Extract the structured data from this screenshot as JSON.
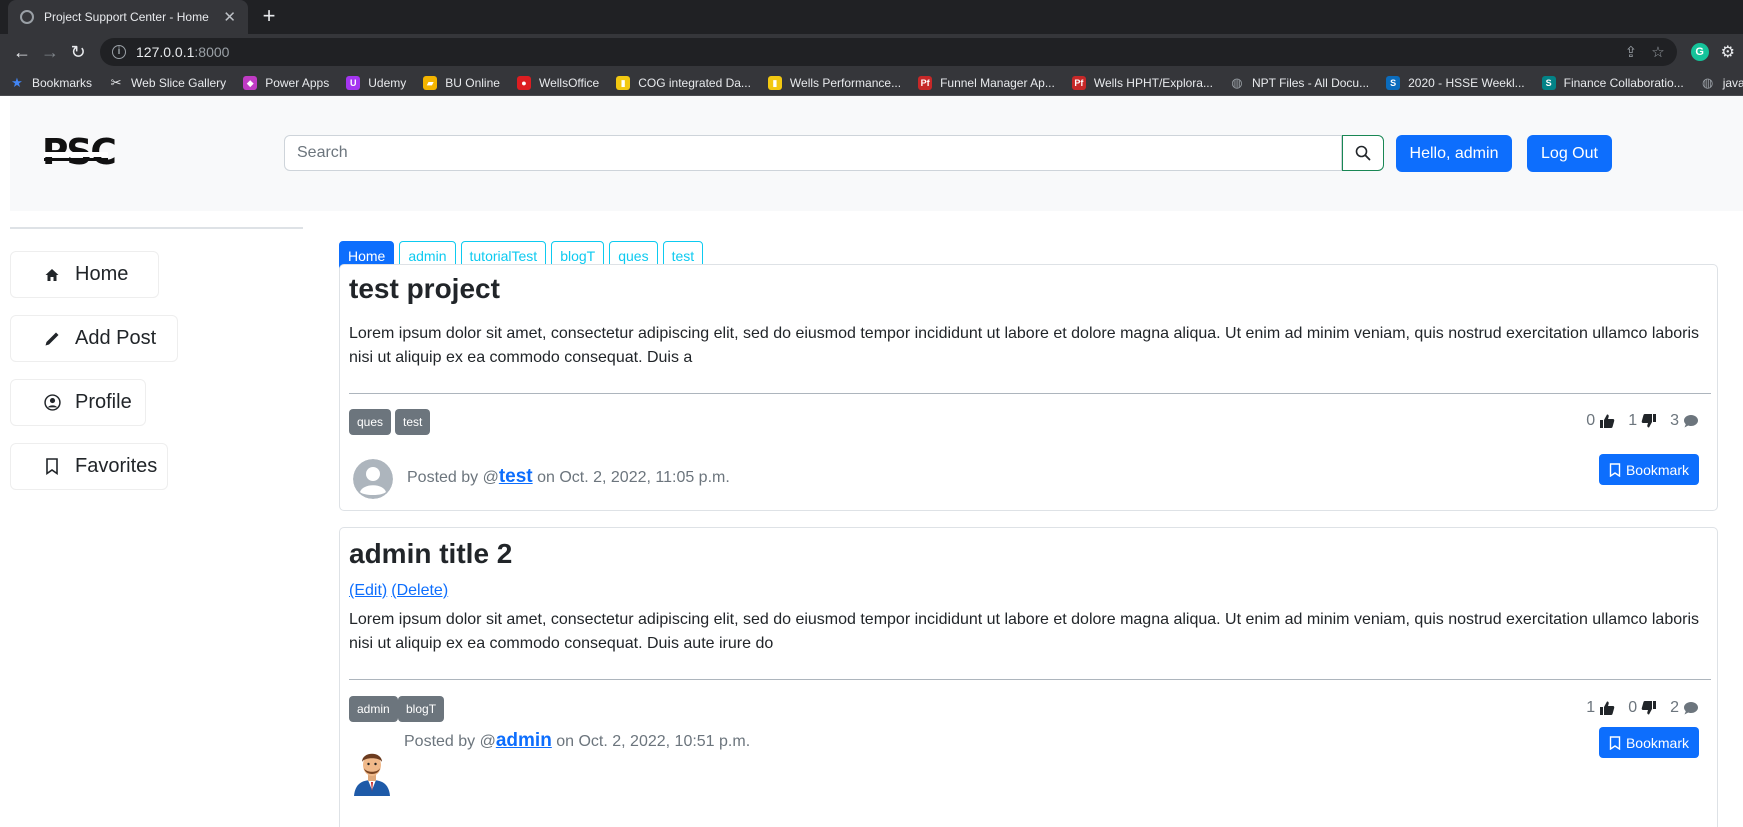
{
  "browser": {
    "tab_title": "Project Support Center - Home",
    "url_host": "127.0.0.1",
    "url_port": ":8000",
    "bookmarks": [
      {
        "label": "Bookmarks",
        "icon": "star-icon",
        "color": "#4285f4"
      },
      {
        "label": "Web Slice Gallery",
        "icon": "web-slice-icon",
        "color": "#e8eaed"
      },
      {
        "label": "Power Apps",
        "icon": "power-apps-icon",
        "color": "#c03bc4"
      },
      {
        "label": "Udemy",
        "icon": "udemy-icon",
        "color": "#a435f0"
      },
      {
        "label": "BU Online",
        "icon": "bu-online-icon",
        "color": "#f4b400"
      },
      {
        "label": "WellsOffice",
        "icon": "shell-icon",
        "color": "#dd1d21"
      },
      {
        "label": "COG integrated Da...",
        "icon": "powerbi-icon",
        "color": "#f2c811"
      },
      {
        "label": "Wells Performance...",
        "icon": "powerbi-icon",
        "color": "#f2c811"
      },
      {
        "label": "Funnel Manager Ap...",
        "icon": "pf-icon",
        "color": "#c62828"
      },
      {
        "label": "Wells HPHT/Explora...",
        "icon": "pf-icon",
        "color": "#c62828"
      },
      {
        "label": "NPT Files - All Docu...",
        "icon": "globe-icon",
        "color": "#9aa0a6"
      },
      {
        "label": "2020 - HSSE Weekl...",
        "icon": "sharepoint-icon",
        "color": "#0b6cbd"
      },
      {
        "label": "Finance Collaboratio...",
        "icon": "sharepoint-icon",
        "color": "#038387"
      },
      {
        "label": "javascript",
        "icon": "globe-icon",
        "color": "#9aa0a6"
      }
    ]
  },
  "header": {
    "logo_text": "PSC",
    "search_placeholder": "Search",
    "hello_label": "Hello, admin",
    "logout_label": "Log Out"
  },
  "sidebar": {
    "items": [
      {
        "label": "Home",
        "icon": "house-icon"
      },
      {
        "label": "Add Post",
        "icon": "pencil-icon"
      },
      {
        "label": "Profile",
        "icon": "person-circle-icon"
      },
      {
        "label": "Favorites",
        "icon": "bookmark-icon"
      }
    ]
  },
  "filters": [
    "Home",
    "admin",
    "tutorialTest",
    "blogT",
    "ques",
    "test"
  ],
  "posts": [
    {
      "title": "test project",
      "body": "Lorem ipsum dolor sit amet, consectetur adipiscing elit, sed do eiusmod tempor incididunt ut labore et dolore magna aliqua. Ut enim ad minim veniam, quis nostrud exercitation ullamco laboris nisi ut aliquip ex ea commodo consequat. Duis a",
      "tags": [
        "ques",
        "test"
      ],
      "likes": "0",
      "dislikes": "1",
      "comments": "3",
      "posted_prefix": "Posted by @",
      "author": "test",
      "posted_suffix": " on Oct. 2, 2022, 11:05 p.m.",
      "bookmark_label": "Bookmark"
    },
    {
      "title": "admin title 2",
      "edit_label": "(Edit)",
      "delete_label": "(Delete)",
      "body": "Lorem ipsum dolor sit amet, consectetur adipiscing elit, sed do eiusmod tempor incididunt ut labore et dolore magna aliqua. Ut enim ad minim veniam, quis nostrud exercitation ullamco laboris nisi ut aliquip ex ea commodo consequat. Duis aute irure do",
      "tags": [
        "admin",
        "blogT"
      ],
      "likes": "1",
      "dislikes": "0",
      "comments": "2",
      "posted_prefix": "Posted by @",
      "author": "admin",
      "posted_suffix": " on Oct. 2, 2022, 10:51 p.m.",
      "bookmark_label": "Bookmark"
    }
  ]
}
